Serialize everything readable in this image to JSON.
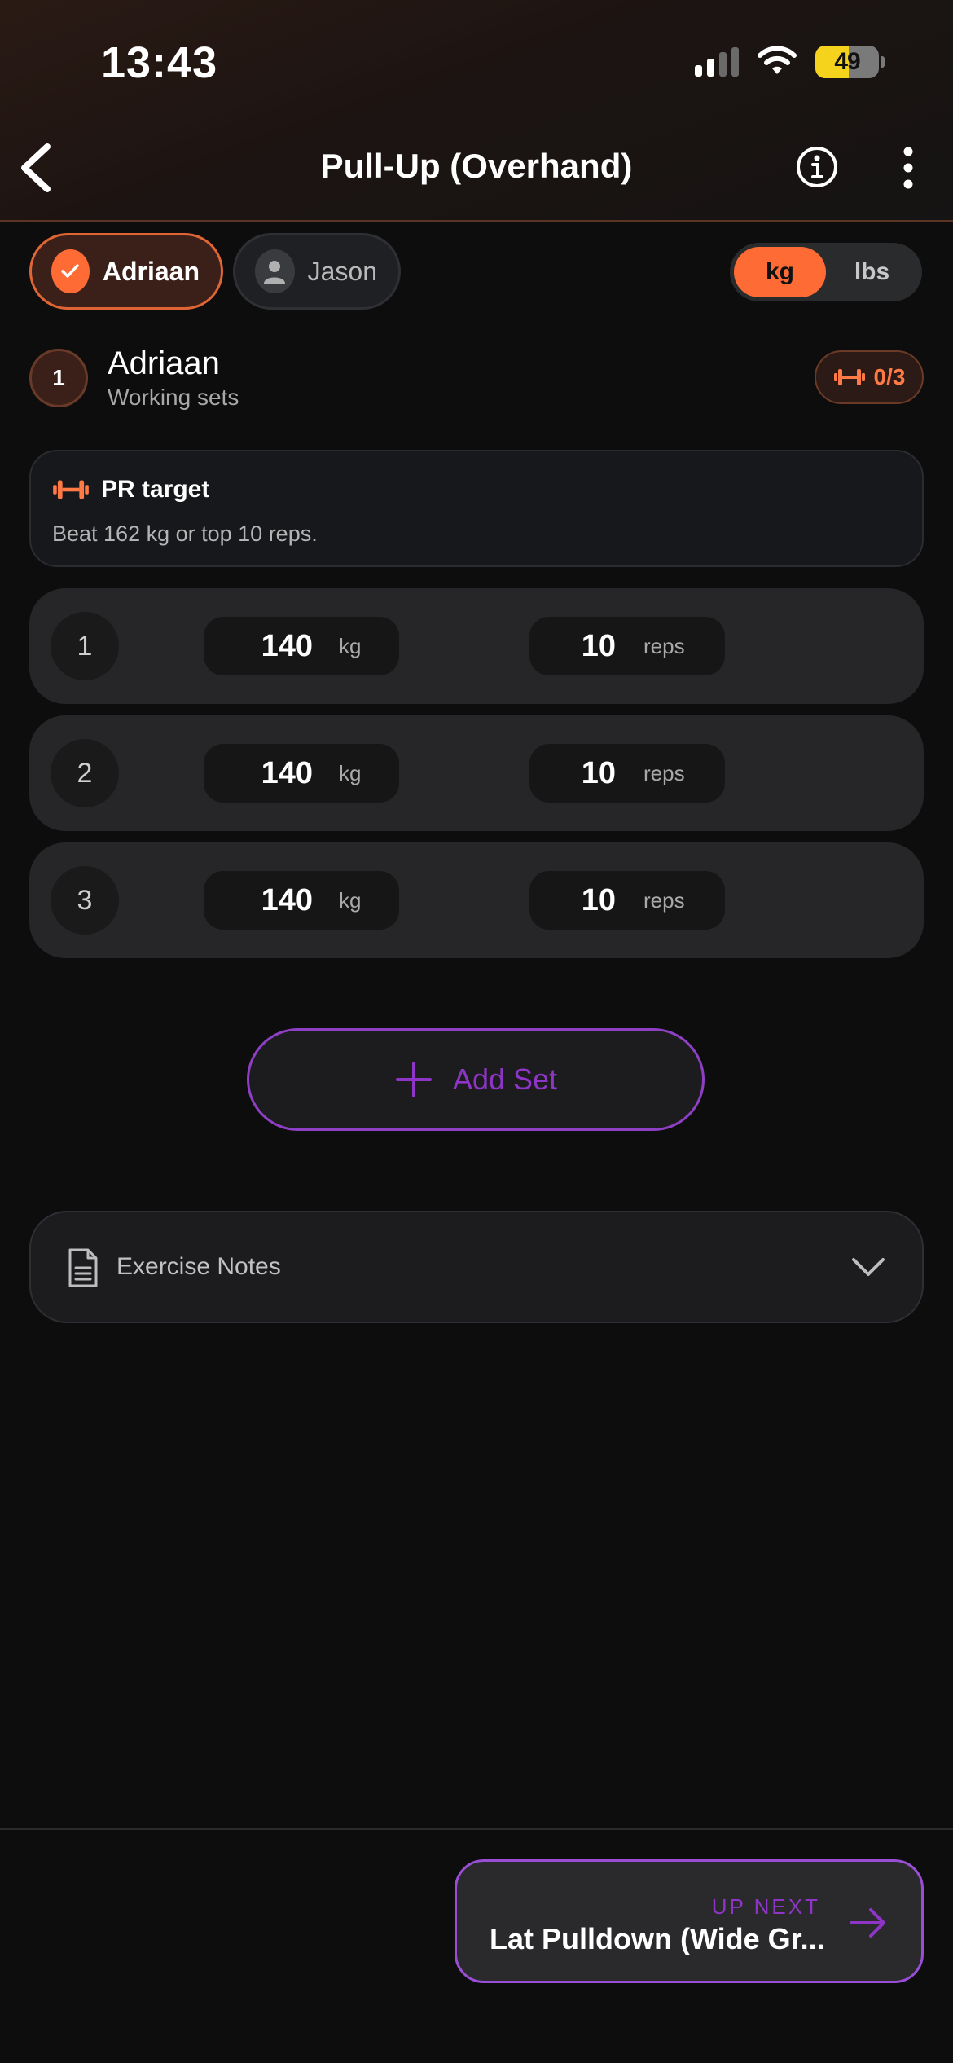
{
  "status_bar": {
    "time": "13:43",
    "battery": "49"
  },
  "nav": {
    "title": "Pull-Up (Overhand)"
  },
  "users": [
    {
      "name": "Adriaan",
      "selected": true
    },
    {
      "name": "Jason",
      "selected": false
    }
  ],
  "units": {
    "options": [
      "kg",
      "lbs"
    ],
    "selected": "kg"
  },
  "section": {
    "index": "1",
    "name": "Adriaan",
    "subtitle": "Working sets",
    "progress": "0/3"
  },
  "pr_target": {
    "title": "PR target",
    "description": "Beat 162 kg or top 10 reps."
  },
  "sets": [
    {
      "num": "1",
      "weight": "140",
      "weight_unit": "kg",
      "reps": "10",
      "reps_unit": "reps"
    },
    {
      "num": "2",
      "weight": "140",
      "weight_unit": "kg",
      "reps": "10",
      "reps_unit": "reps"
    },
    {
      "num": "3",
      "weight": "140",
      "weight_unit": "kg",
      "reps": "10",
      "reps_unit": "reps"
    }
  ],
  "add_set_label": "Add Set",
  "notes_label": "Exercise Notes",
  "up_next": {
    "kicker": "UP NEXT",
    "label": "Lat Pulldown (Wide Gr..."
  },
  "colors": {
    "accent": "#ff6b35",
    "purple": "#8e35c8",
    "background": "#0d0d0e"
  }
}
